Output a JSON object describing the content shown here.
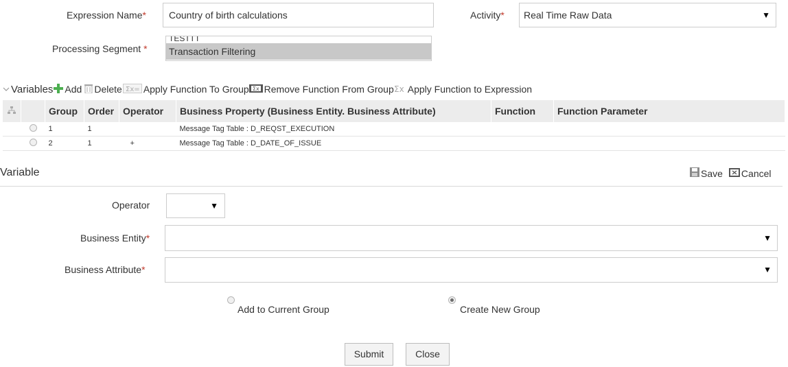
{
  "expression": {
    "name_label": "Expression Name",
    "name_value": "Country of birth calculations",
    "activity_label": "Activity",
    "activity_value": "Real Time Raw Data",
    "segment_label": "Processing Segment",
    "segment_options": [
      "TESTTT",
      "Transaction Filtering"
    ],
    "required_mark": "*"
  },
  "variables_toolbar": {
    "title": "Variables",
    "add": "Add",
    "delete": "Delete",
    "apply_group": "Apply Function To Group",
    "remove_group": "Remove Function From Group",
    "apply_expression": "Apply Function to Expression"
  },
  "grid": {
    "columns": [
      "Group",
      "Order",
      "Operator",
      "Business Property (Business Entity. Business Attribute)",
      "Function",
      "Function Parameter"
    ],
    "rows": [
      {
        "group": "1",
        "order": "1",
        "operator": "",
        "property": "Message Tag Table : D_REQST_EXECUTION",
        "function": "",
        "parameter": ""
      },
      {
        "group": "2",
        "order": "1",
        "operator": "+",
        "property": "Message Tag Table : D_DATE_OF_ISSUE",
        "function": "",
        "parameter": ""
      }
    ]
  },
  "variable_panel": {
    "title": "Variable",
    "save": "Save",
    "cancel": "Cancel",
    "operator_label": "Operator",
    "operator_value": "",
    "entity_label": "Business Entity",
    "entity_value": "",
    "attribute_label": "Business Attribute",
    "attribute_value": "",
    "radio_add_current": "Add to Current Group",
    "radio_create_new": "Create New Group",
    "selected_radio": "create_new"
  },
  "buttons": {
    "submit": "Submit",
    "close": "Close"
  },
  "icons": {
    "add": "plus-icon",
    "delete": "trash-icon",
    "apply_group": "sigma-icon",
    "remove_group": "remove-function-icon",
    "apply_expression": "sigma-x-icon",
    "save": "floppy-disk-icon",
    "cancel": "cancel-icon",
    "collapse": "chevron-down-icon",
    "grid_corner": "hierarchy-icon"
  },
  "colors": {
    "required": "#c0392b",
    "add_icon": "#4caf50",
    "header_bg": "#ececec",
    "selected_option": "#c8c8c8"
  }
}
